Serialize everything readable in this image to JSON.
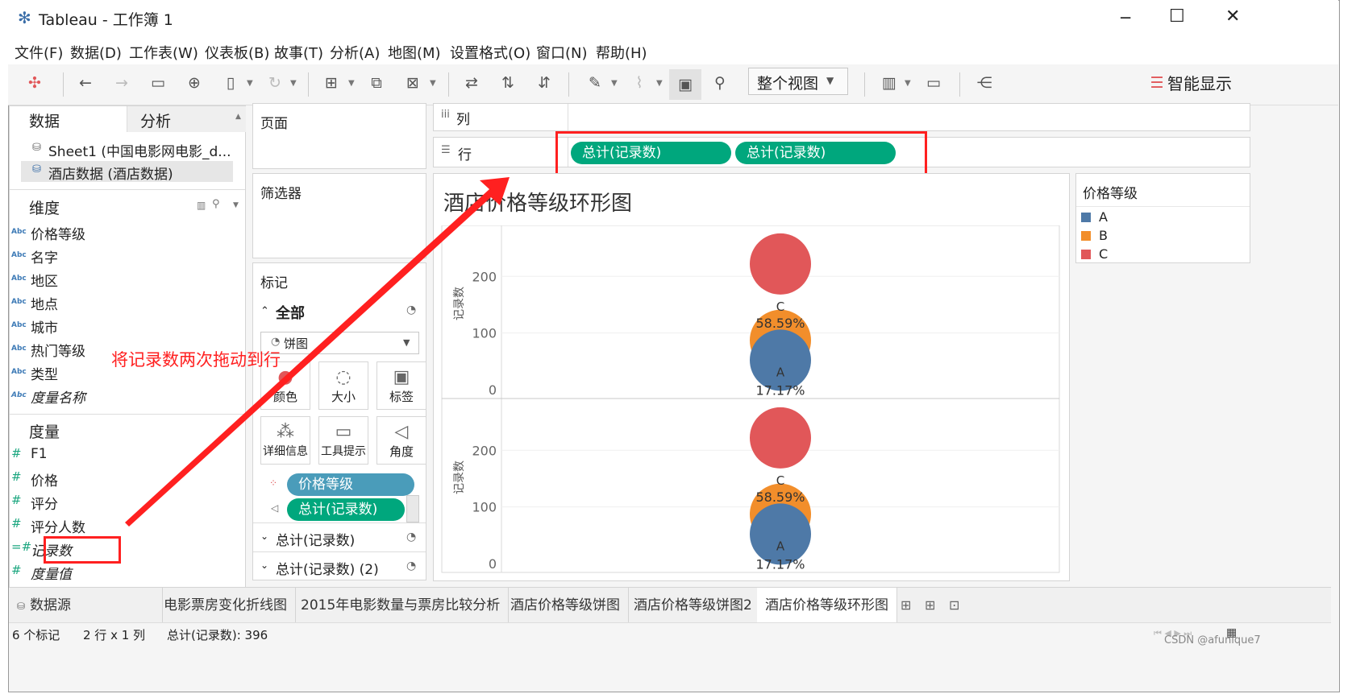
{
  "window": {
    "title": "Tableau - 工作簿 1",
    "minimize": "─",
    "maximize": "☐",
    "close": "✕"
  },
  "menu": [
    "文件(F)",
    "数据(D)",
    "工作表(W)",
    "仪表板(B)",
    "故事(T)",
    "分析(A)",
    "地图(M)",
    "设置格式(O)",
    "窗口(N)",
    "帮助(H)"
  ],
  "toolbar": {
    "fit_select": "整个视图",
    "show_me": "智能显示"
  },
  "side": {
    "tabs": [
      "数据",
      "分析"
    ],
    "sources": [
      "Sheet1 (中国电影网电影_d...",
      "酒店数据 (酒店数据)"
    ],
    "dimensions_title": "维度",
    "dimensions": [
      "价格等级",
      "名字",
      "地区",
      "地点",
      "城市",
      "热门等级",
      "类型",
      "度量名称"
    ],
    "measures_title": "度量",
    "measures": [
      "F1",
      "价格",
      "评分",
      "评分人数",
      "记录数",
      "度量值"
    ]
  },
  "shelves": {
    "pages": "页面",
    "filters": "筛选器",
    "columns": "列",
    "rows": "行",
    "row_pills": [
      "总计(记录数)",
      "总计(记录数)"
    ]
  },
  "marks": {
    "title": "标记",
    "all": "全部",
    "type": "饼图",
    "buttons": [
      "颜色",
      "大小",
      "标签",
      "详细信息",
      "工具提示",
      "角度"
    ],
    "fields": [
      "价格等级",
      "总计(记录数)"
    ],
    "sections": [
      "总计(记录数)",
      "总计(记录数) (2)"
    ]
  },
  "annotation": "将记录数两次拖动到行",
  "chart_data": {
    "type": "pie",
    "title": "酒店价格等级环形图",
    "ylabel": "记录数",
    "yticks": [
      0,
      100,
      200
    ],
    "ylim": [
      0,
      290
    ],
    "panes": [
      {
        "slices": [
          {
            "label": "A",
            "pct": "17.17%",
            "color": "#4e79a7",
            "y": 52
          },
          {
            "label": "B",
            "pct": "",
            "color": "#f28e2b",
            "y": 87
          },
          {
            "label": "C",
            "pct": "58.59%",
            "color": "#e15759",
            "y": 222
          }
        ]
      },
      {
        "slices": [
          {
            "label": "A",
            "pct": "17.17%",
            "color": "#4e79a7",
            "y": 52
          },
          {
            "label": "B",
            "pct": "",
            "color": "#f28e2b",
            "y": 87
          },
          {
            "label": "C",
            "pct": "58.59%",
            "color": "#e15759",
            "y": 222
          }
        ]
      }
    ],
    "legend": {
      "title": "价格等级",
      "items": [
        {
          "label": "A",
          "color": "#4e79a7"
        },
        {
          "label": "B",
          "color": "#f28e2b"
        },
        {
          "label": "C",
          "color": "#e15759"
        }
      ]
    }
  },
  "sheet_tabs": [
    "数据源",
    "电影票房变化折线图",
    "2015年电影数量与票房比较分析",
    "酒店价格等级饼图",
    "酒店价格等级饼图2",
    "酒店价格等级环形图"
  ],
  "status": {
    "marks": "6 个标记",
    "layout": "2 行 x 1 列",
    "sum": "总计(记录数): 396"
  },
  "watermark": "CSDN @afunique7"
}
